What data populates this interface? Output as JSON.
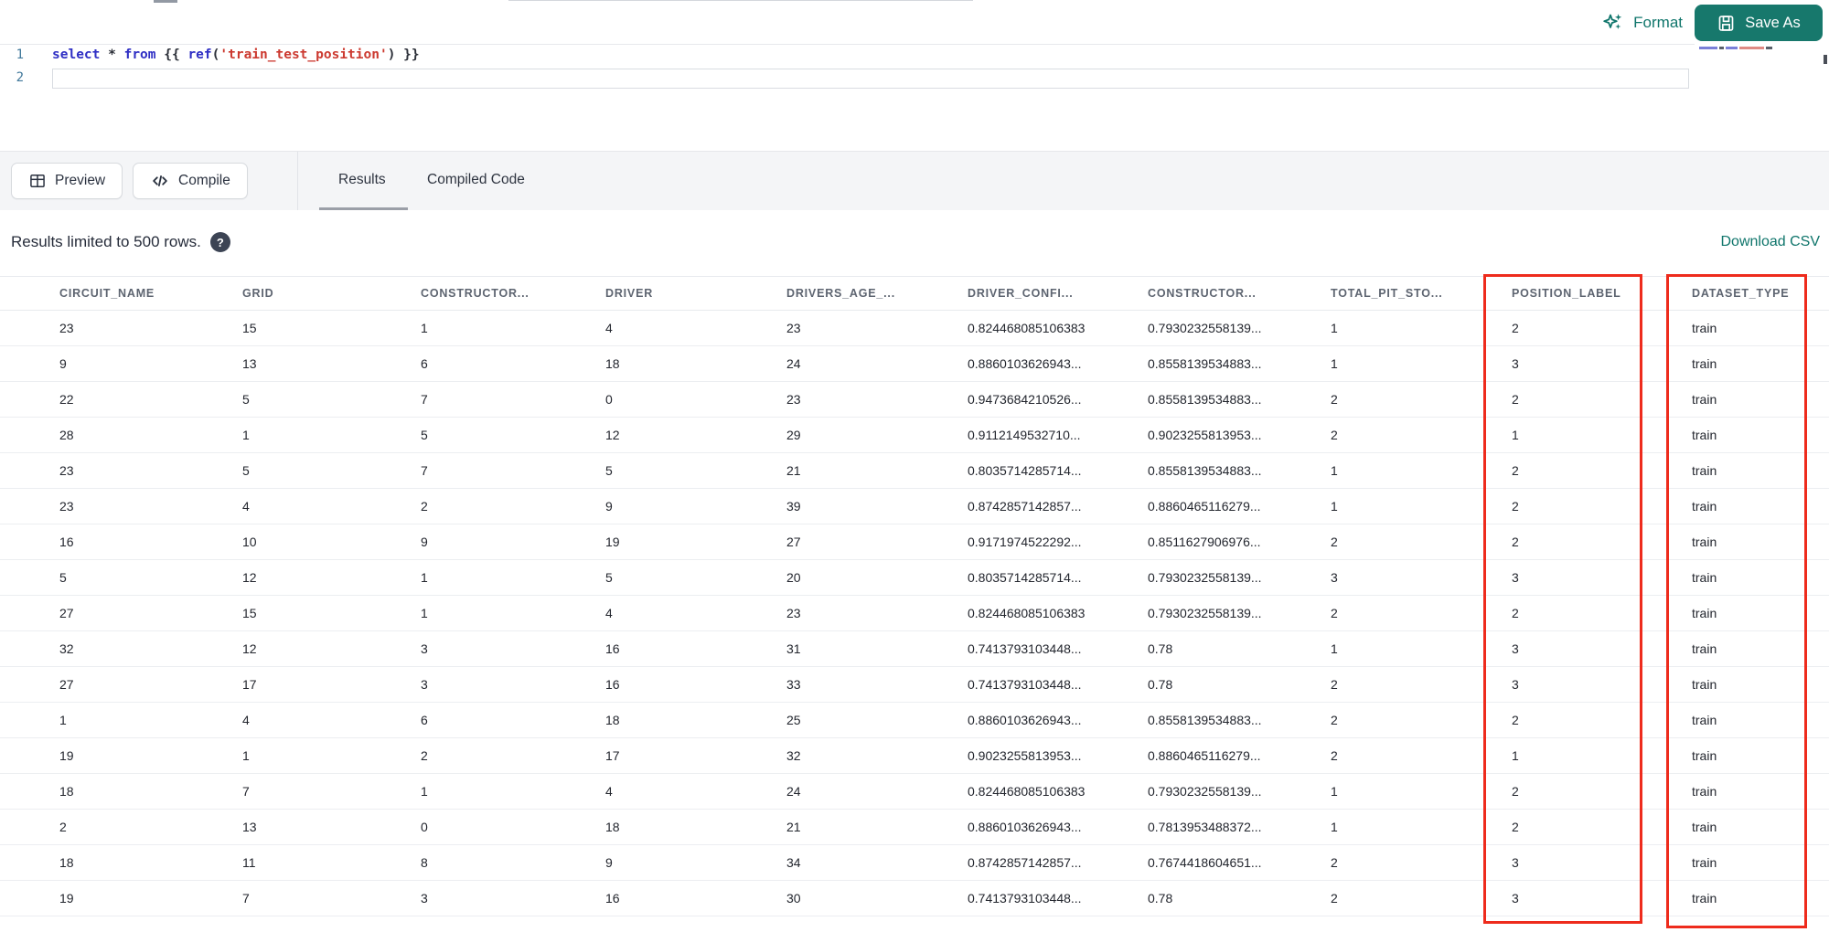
{
  "colors": {
    "accent_teal": "#0F756B",
    "save_button_bg": "#17786C",
    "highlight_red": "#EE2B1C",
    "keyword_blue": "#2F2FC4",
    "string_red": "#CC3A30",
    "line_number_blue": "#41789B"
  },
  "toolbar": {
    "format_label": "Format",
    "save_as_label": "Save As"
  },
  "editor": {
    "line_numbers": [
      "1",
      "2"
    ],
    "line1_tokens": [
      {
        "text": "select",
        "type": "keyword"
      },
      {
        "text": " * ",
        "type": "plain"
      },
      {
        "text": "from",
        "type": "keyword"
      },
      {
        "text": " {{ ",
        "type": "plain"
      },
      {
        "text": "ref",
        "type": "function"
      },
      {
        "text": "(",
        "type": "plain"
      },
      {
        "text": "'train_test_position'",
        "type": "string"
      },
      {
        "text": ") }}",
        "type": "plain"
      }
    ]
  },
  "actions": {
    "preview_label": "Preview",
    "compile_label": "Compile"
  },
  "tabs": [
    {
      "label": "Results",
      "active": true
    },
    {
      "label": "Compiled Code",
      "active": false
    }
  ],
  "results": {
    "limit_notice": "Results limited to 500 rows.",
    "download_csv_label": "Download CSV"
  },
  "results_table": {
    "columns": [
      "CIRCUIT_NAME",
      "GRID",
      "CONSTRUCTOR...",
      "DRIVER",
      "DRIVERS_AGE_...",
      "DRIVER_CONFI...",
      "CONSTRUCTOR...",
      "TOTAL_PIT_STO...",
      "POSITION_LABEL",
      "DATASET_TYPE"
    ],
    "highlighted_columns": [
      "POSITION_LABEL",
      "DATASET_TYPE"
    ],
    "rows": [
      [
        "23",
        "15",
        "1",
        "4",
        "23",
        "0.824468085106383",
        "0.7930232558139...",
        "1",
        "2",
        "train"
      ],
      [
        "9",
        "13",
        "6",
        "18",
        "24",
        "0.8860103626943...",
        "0.8558139534883...",
        "1",
        "3",
        "train"
      ],
      [
        "22",
        "5",
        "7",
        "0",
        "23",
        "0.9473684210526...",
        "0.8558139534883...",
        "2",
        "2",
        "train"
      ],
      [
        "28",
        "1",
        "5",
        "12",
        "29",
        "0.9112149532710...",
        "0.9023255813953...",
        "2",
        "1",
        "train"
      ],
      [
        "23",
        "5",
        "7",
        "5",
        "21",
        "0.8035714285714...",
        "0.8558139534883...",
        "1",
        "2",
        "train"
      ],
      [
        "23",
        "4",
        "2",
        "9",
        "39",
        "0.8742857142857...",
        "0.8860465116279...",
        "1",
        "2",
        "train"
      ],
      [
        "16",
        "10",
        "9",
        "19",
        "27",
        "0.9171974522292...",
        "0.8511627906976...",
        "2",
        "2",
        "train"
      ],
      [
        "5",
        "12",
        "1",
        "5",
        "20",
        "0.8035714285714...",
        "0.7930232558139...",
        "3",
        "3",
        "train"
      ],
      [
        "27",
        "15",
        "1",
        "4",
        "23",
        "0.824468085106383",
        "0.7930232558139...",
        "2",
        "2",
        "train"
      ],
      [
        "32",
        "12",
        "3",
        "16",
        "31",
        "0.7413793103448...",
        "0.78",
        "1",
        "3",
        "train"
      ],
      [
        "27",
        "17",
        "3",
        "16",
        "33",
        "0.7413793103448...",
        "0.78",
        "2",
        "3",
        "train"
      ],
      [
        "1",
        "4",
        "6",
        "18",
        "25",
        "0.8860103626943...",
        "0.8558139534883...",
        "2",
        "2",
        "train"
      ],
      [
        "19",
        "1",
        "2",
        "17",
        "32",
        "0.9023255813953...",
        "0.8860465116279...",
        "2",
        "1",
        "train"
      ],
      [
        "18",
        "7",
        "1",
        "4",
        "24",
        "0.824468085106383",
        "0.7930232558139...",
        "1",
        "2",
        "train"
      ],
      [
        "2",
        "13",
        "0",
        "18",
        "21",
        "0.8860103626943...",
        "0.7813953488372...",
        "1",
        "2",
        "train"
      ],
      [
        "18",
        "11",
        "8",
        "9",
        "34",
        "0.8742857142857...",
        "0.7674418604651...",
        "2",
        "3",
        "train"
      ],
      [
        "19",
        "7",
        "3",
        "16",
        "30",
        "0.7413793103448...",
        "0.78",
        "2",
        "3",
        "train"
      ]
    ]
  }
}
